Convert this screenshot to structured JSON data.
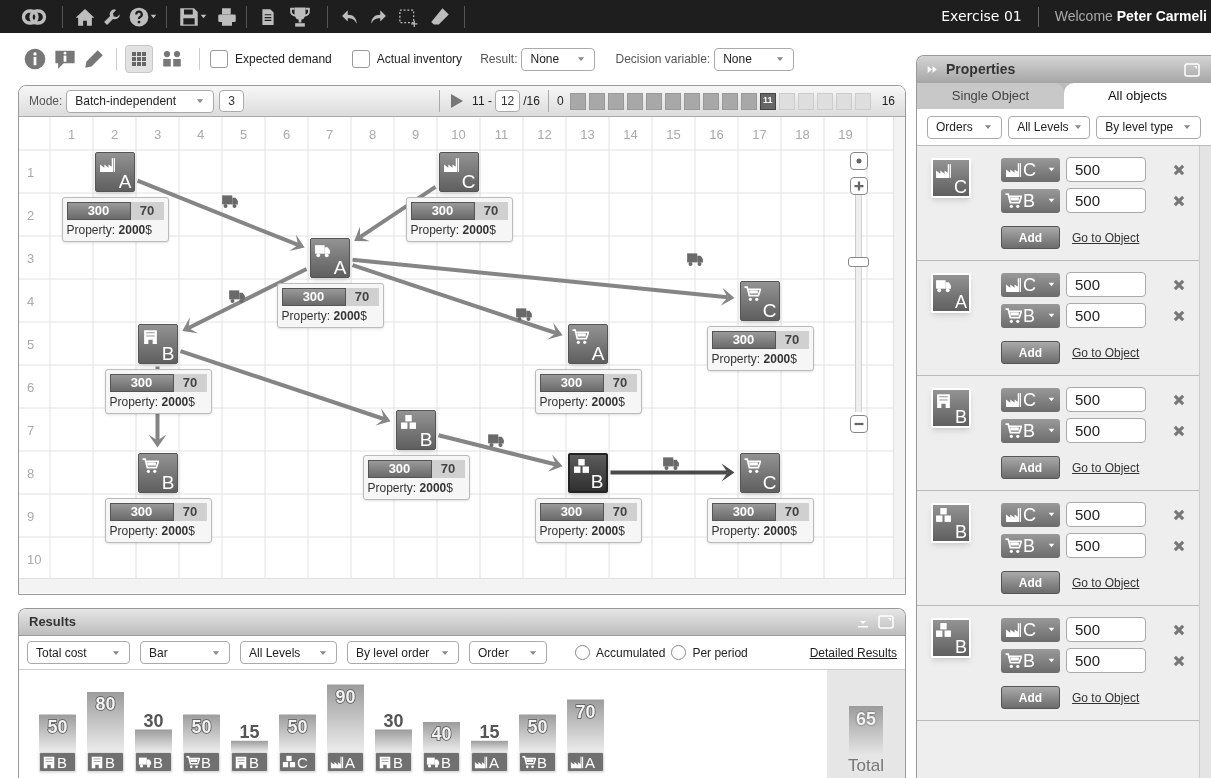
{
  "top_bar": {
    "exercise": "Exercise 01",
    "welcome": "Welcome **Peter Carmeli**"
  },
  "toolbar": {
    "grid_button": {
      "selected": true
    },
    "checkboxes": [
      {
        "label": "Expected demand",
        "checked": false
      },
      {
        "label": "Actual inventory",
        "checked": false
      }
    ],
    "result": {
      "label": "Result:",
      "value": "None"
    },
    "decision_variable": {
      "label": "Decision variable:",
      "value": "None"
    }
  },
  "grid_panel": {
    "mode": {
      "label": "Mode:",
      "value": "Batch-independent"
    },
    "batch_size": "3",
    "step": {
      "from": "11 -",
      "current": "12",
      "total": "/16"
    },
    "timeline": {
      "start": "0",
      "end": "16",
      "periods": [
        {
          "done": true,
          "selected": false
        },
        {
          "done": true,
          "selected": false
        },
        {
          "done": true,
          "selected": false
        },
        {
          "done": true,
          "selected": false
        },
        {
          "done": true,
          "selected": false
        },
        {
          "done": true,
          "selected": false
        },
        {
          "done": true,
          "selected": false
        },
        {
          "done": true,
          "selected": false
        },
        {
          "done": true,
          "selected": false
        },
        {
          "done": true,
          "selected": false
        },
        {
          "done": true,
          "selected": true,
          "label": "11"
        },
        {
          "done": false,
          "selected": false
        },
        {
          "done": false,
          "selected": false
        },
        {
          "done": false,
          "selected": false
        },
        {
          "done": false,
          "selected": false
        },
        {
          "done": false,
          "selected": false
        }
      ]
    },
    "columns": [
      "1",
      "2",
      "3",
      "4",
      "5",
      "6",
      "7",
      "8",
      "9",
      "10",
      "11",
      "12",
      "13",
      "14",
      "15",
      "16",
      "17",
      "18",
      "19"
    ],
    "rows": [
      "1",
      "2",
      "3",
      "4",
      "5",
      "6",
      "7",
      "8",
      "9",
      "10"
    ],
    "zoom": {
      "level": 0.7
    },
    "nodes": [
      {
        "kind": "factory",
        "letter": "A",
        "quantity": "300",
        "remainder": "70",
        "property": "Property: **2000**$",
        "selected": false
      },
      {
        "kind": "factory",
        "letter": "C",
        "quantity": "300",
        "remainder": "70",
        "property": "Property: **2000**$",
        "selected": false
      },
      {
        "kind": "truck",
        "letter": "A",
        "quantity": "300",
        "remainder": "70",
        "property": "Property: **2000**$",
        "selected": false
      },
      {
        "kind": "cart",
        "letter": "C",
        "quantity": "300",
        "remainder": "70",
        "property": "Property: **2000**$",
        "selected": false
      },
      {
        "kind": "building",
        "letter": "B",
        "quantity": "300",
        "remainder": "70",
        "property": "Property: **2000**$",
        "selected": false
      },
      {
        "kind": "cart",
        "letter": "A",
        "quantity": "300",
        "remainder": "70",
        "property": "Property: **2000**$",
        "selected": false
      },
      {
        "kind": "boxes",
        "letter": "B",
        "quantity": "300",
        "remainder": "70",
        "property": "Property: **2000**$",
        "selected": false
      },
      {
        "kind": "cart",
        "letter": "B",
        "quantity": "300",
        "remainder": "70",
        "property": "Property: **2000**$",
        "selected": false
      },
      {
        "kind": "boxes",
        "letter": "B",
        "quantity": "300",
        "remainder": "70",
        "property": "Property: **2000**$",
        "selected": true
      },
      {
        "kind": "cart",
        "letter": "C",
        "quantity": "300",
        "remainder": "70",
        "property": "Property: **2000**$",
        "selected": false
      }
    ]
  },
  "results": {
    "title": "Results",
    "filters": [
      "Total cost",
      "Bar",
      "All Levels",
      "By level order",
      "Order"
    ],
    "options": [
      {
        "label": "Accumulated",
        "selected": false
      },
      {
        "label": "Per period",
        "selected": false
      }
    ],
    "link": "Detailed Results",
    "category_icons": [
      {
        "kind": "building"
      },
      {
        "kind": "building"
      },
      {
        "kind": "truck"
      },
      {
        "kind": "cart"
      },
      {
        "kind": "building"
      },
      {
        "kind": "boxes"
      },
      {
        "kind": "factory"
      },
      {
        "kind": "building"
      },
      {
        "kind": "truck"
      },
      {
        "kind": "factory"
      },
      {
        "kind": "cart"
      },
      {
        "kind": "factory"
      }
    ],
    "chart_data": {
      "type": "bar",
      "categories": [
        "B",
        "B",
        "B",
        "B",
        "B",
        "C",
        "A",
        "B",
        "B",
        "A",
        "B",
        "A"
      ],
      "values": [
        50,
        80,
        30,
        50,
        15,
        50,
        90,
        30,
        40,
        15,
        50,
        70
      ],
      "data_labels": true
    },
    "total": {
      "value": "65",
      "label": "Total"
    }
  },
  "properties": {
    "title": "Properties",
    "tabs": [
      {
        "label": "Single Object",
        "selected": false
      },
      {
        "label": "All objects",
        "selected": true
      }
    ],
    "filters": [
      "Orders",
      "All Levels",
      "By level type"
    ],
    "objects": [
      {
        "kind": "factory",
        "letter": "C",
        "orders": [
          {
            "kind": "factory",
            "letter": "C",
            "value": "500"
          },
          {
            "kind": "cart",
            "letter": "B",
            "value": "500"
          }
        ],
        "add": "Add",
        "link": "Go to Object"
      },
      {
        "kind": "truck",
        "letter": "A",
        "orders": [
          {
            "kind": "factory",
            "letter": "C",
            "value": "500"
          },
          {
            "kind": "cart",
            "letter": "B",
            "value": "500"
          }
        ],
        "add": "Add",
        "link": "Go to Object"
      },
      {
        "kind": "building",
        "letter": "B",
        "orders": [
          {
            "kind": "factory",
            "letter": "C",
            "value": "500"
          },
          {
            "kind": "cart",
            "letter": "B",
            "value": "500"
          }
        ],
        "add": "Add",
        "link": "Go to Object"
      },
      {
        "kind": "boxes",
        "letter": "B",
        "orders": [
          {
            "kind": "factory",
            "letter": "C",
            "value": "500"
          },
          {
            "kind": "cart",
            "letter": "B",
            "value": "500"
          }
        ],
        "add": "Add",
        "link": "Go to Object"
      },
      {
        "kind": "boxes",
        "letter": "B",
        "orders": [
          {
            "kind": "factory",
            "letter": "C",
            "value": "500"
          },
          {
            "kind": "cart",
            "letter": "B",
            "value": "500"
          }
        ],
        "add": "Add",
        "link": "Go to Object"
      }
    ]
  }
}
